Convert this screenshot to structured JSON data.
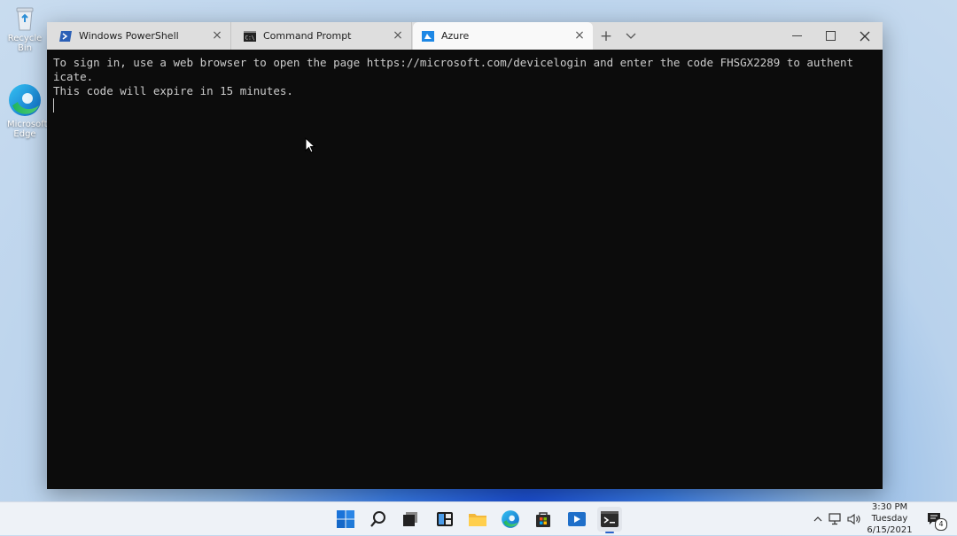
{
  "desktop": {
    "icons": [
      {
        "name": "recycle-bin",
        "label": "Recycle Bin"
      },
      {
        "name": "microsoft-edge",
        "label": "Microsoft Edge"
      }
    ]
  },
  "window": {
    "tabs": [
      {
        "label": "Windows PowerShell",
        "icon": "powershell-icon"
      },
      {
        "label": "Command Prompt",
        "icon": "cmd-icon"
      },
      {
        "label": "Azure",
        "icon": "azure-icon",
        "active": true
      }
    ],
    "new_tab": "+",
    "dropdown": "⌄",
    "minimize": "—",
    "maximize": "☐",
    "close": "✕"
  },
  "terminal": {
    "lines": [
      "To sign in, use a web browser to open the page https://microsoft.com/devicelogin and enter the code FHSGX2289 to authent",
      "icate.",
      "This code will expire in 15 minutes."
    ]
  },
  "taskbar": {
    "apps": [
      "start-icon",
      "search-icon",
      "task-view-icon",
      "widgets-icon",
      "file-explorer-icon",
      "edge-icon",
      "store-icon",
      "media-icon",
      "terminal-icon"
    ],
    "tray": {
      "chevron": "^",
      "network": "network-icon",
      "volume": "volume-icon"
    },
    "clock": {
      "time": "3:30 PM",
      "day": "Tuesday",
      "date": "6/15/2021"
    },
    "notifications": {
      "count": "4"
    }
  },
  "colors": {
    "terminal_bg": "#0c0c0c",
    "terminal_fg": "#cccccc",
    "tabbar_bg": "#dedede",
    "active_tab_bg": "#f9f9f9",
    "accent": "#0078d4"
  }
}
